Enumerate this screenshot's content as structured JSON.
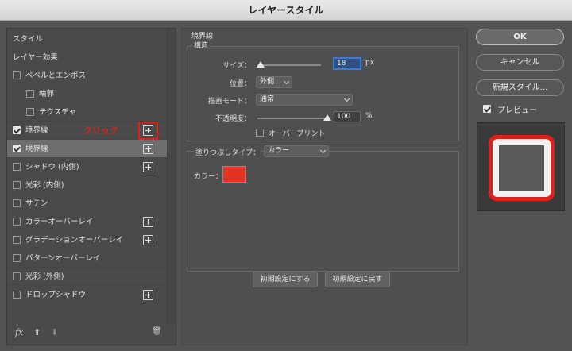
{
  "window": {
    "title": "レイヤースタイル"
  },
  "left_panel": {
    "items": [
      {
        "label": "スタイル",
        "kind": "header"
      },
      {
        "label": "レイヤー効果",
        "kind": "header"
      },
      {
        "label": "ベベルとエンボス",
        "checked": false
      },
      {
        "label": "輪郭",
        "checked": false,
        "indent": true
      },
      {
        "label": "テクスチャ",
        "checked": false,
        "indent": true
      },
      {
        "label": "境界線",
        "checked": true,
        "plus": true,
        "callout": true
      },
      {
        "label": "境界線",
        "checked": true,
        "plus": true,
        "selected": true
      },
      {
        "label": "シャドウ (内側)",
        "checked": false,
        "plus": true
      },
      {
        "label": "光彩 (内側)",
        "checked": false
      },
      {
        "label": "サテン",
        "checked": false
      },
      {
        "label": "カラーオーバーレイ",
        "checked": false,
        "plus": true
      },
      {
        "label": "グラデーションオーバーレイ",
        "checked": false,
        "plus": true
      },
      {
        "label": "パターンオーバーレイ",
        "checked": false
      },
      {
        "label": "光彩 (外側)",
        "checked": false
      },
      {
        "label": "ドロップシャドウ",
        "checked": false,
        "plus": true
      }
    ],
    "callout_text": "クリック",
    "footer": {
      "fx": "fx",
      "up": "⬆",
      "down": "⬇",
      "trash": "🗑"
    }
  },
  "stroke": {
    "section_title": "境界線",
    "structure_title": "構造",
    "size_label": "サイズ：",
    "size_value": "18",
    "size_unit": "px",
    "position_label": "位置：",
    "position_value": "外側",
    "blend_label": "描画モード：",
    "blend_value": "通常",
    "opacity_label": "不透明度：",
    "opacity_value": "100",
    "opacity_unit": "%",
    "overprint_label": "オーバープリント",
    "overprint_checked": false,
    "fill_type_label": "塗りつぶしタイプ：",
    "fill_type_value": "カラー",
    "color_label": "カラー：",
    "color_hex": "#e23324",
    "size_slider_fraction": 0.05,
    "opacity_slider_fraction": 1.0
  },
  "buttons": {
    "make_default": "初期設定にする",
    "reset_default": "初期設定に戻す",
    "ok": "OK",
    "cancel": "キャンセル",
    "new_style": "新規スタイル...",
    "preview_label": "プレビュー",
    "preview_checked": true
  },
  "colors": {
    "accent_red": "#e0211a",
    "focus_blue": "#3f7bd6"
  }
}
